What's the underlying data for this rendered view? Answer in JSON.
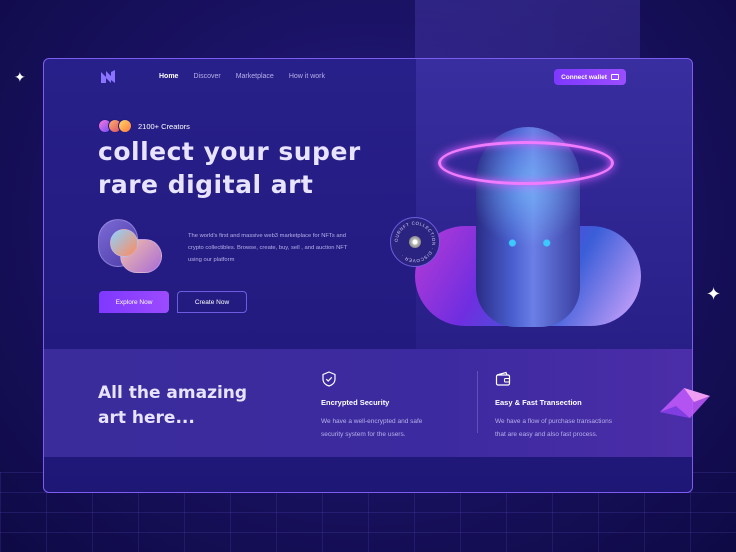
{
  "nav": {
    "items": [
      {
        "label": "Home",
        "active": true
      },
      {
        "label": "Discover",
        "active": false
      },
      {
        "label": "Marketplace",
        "active": false
      },
      {
        "label": "How it work",
        "active": false
      }
    ],
    "connect_label": "Connect wallet"
  },
  "hero": {
    "creators_label": "2100+ Creators",
    "headline_line1": "collect your super",
    "headline_line2": "rare digital art",
    "description": "The world's first and massive web3 marketplace for NFTs and crypto collectibles. Browse, create, buy, sell , and auction NFT using our platform",
    "explore_label": "Explore Now",
    "create_label": "Create Now",
    "badge_text": "OURNFT COLLECTION · DISCOVER ·"
  },
  "features": {
    "title_line1": "All the amazing",
    "title_line2": "art here...",
    "items": [
      {
        "icon": "shield-check-icon",
        "title": "Encrypted Security",
        "desc_line1": "We have a well-encrypted and safe",
        "desc_line2": "security system for the users."
      },
      {
        "icon": "wallet-icon",
        "title": "Easy & Fast Transection",
        "desc_line1": "We have a flow of purchase transactions",
        "desc_line2": "that are easy and also fast process."
      }
    ]
  },
  "colors": {
    "accent": "#8a3fff",
    "frame_border": "#7d5cf0",
    "background": "#1a1264"
  }
}
